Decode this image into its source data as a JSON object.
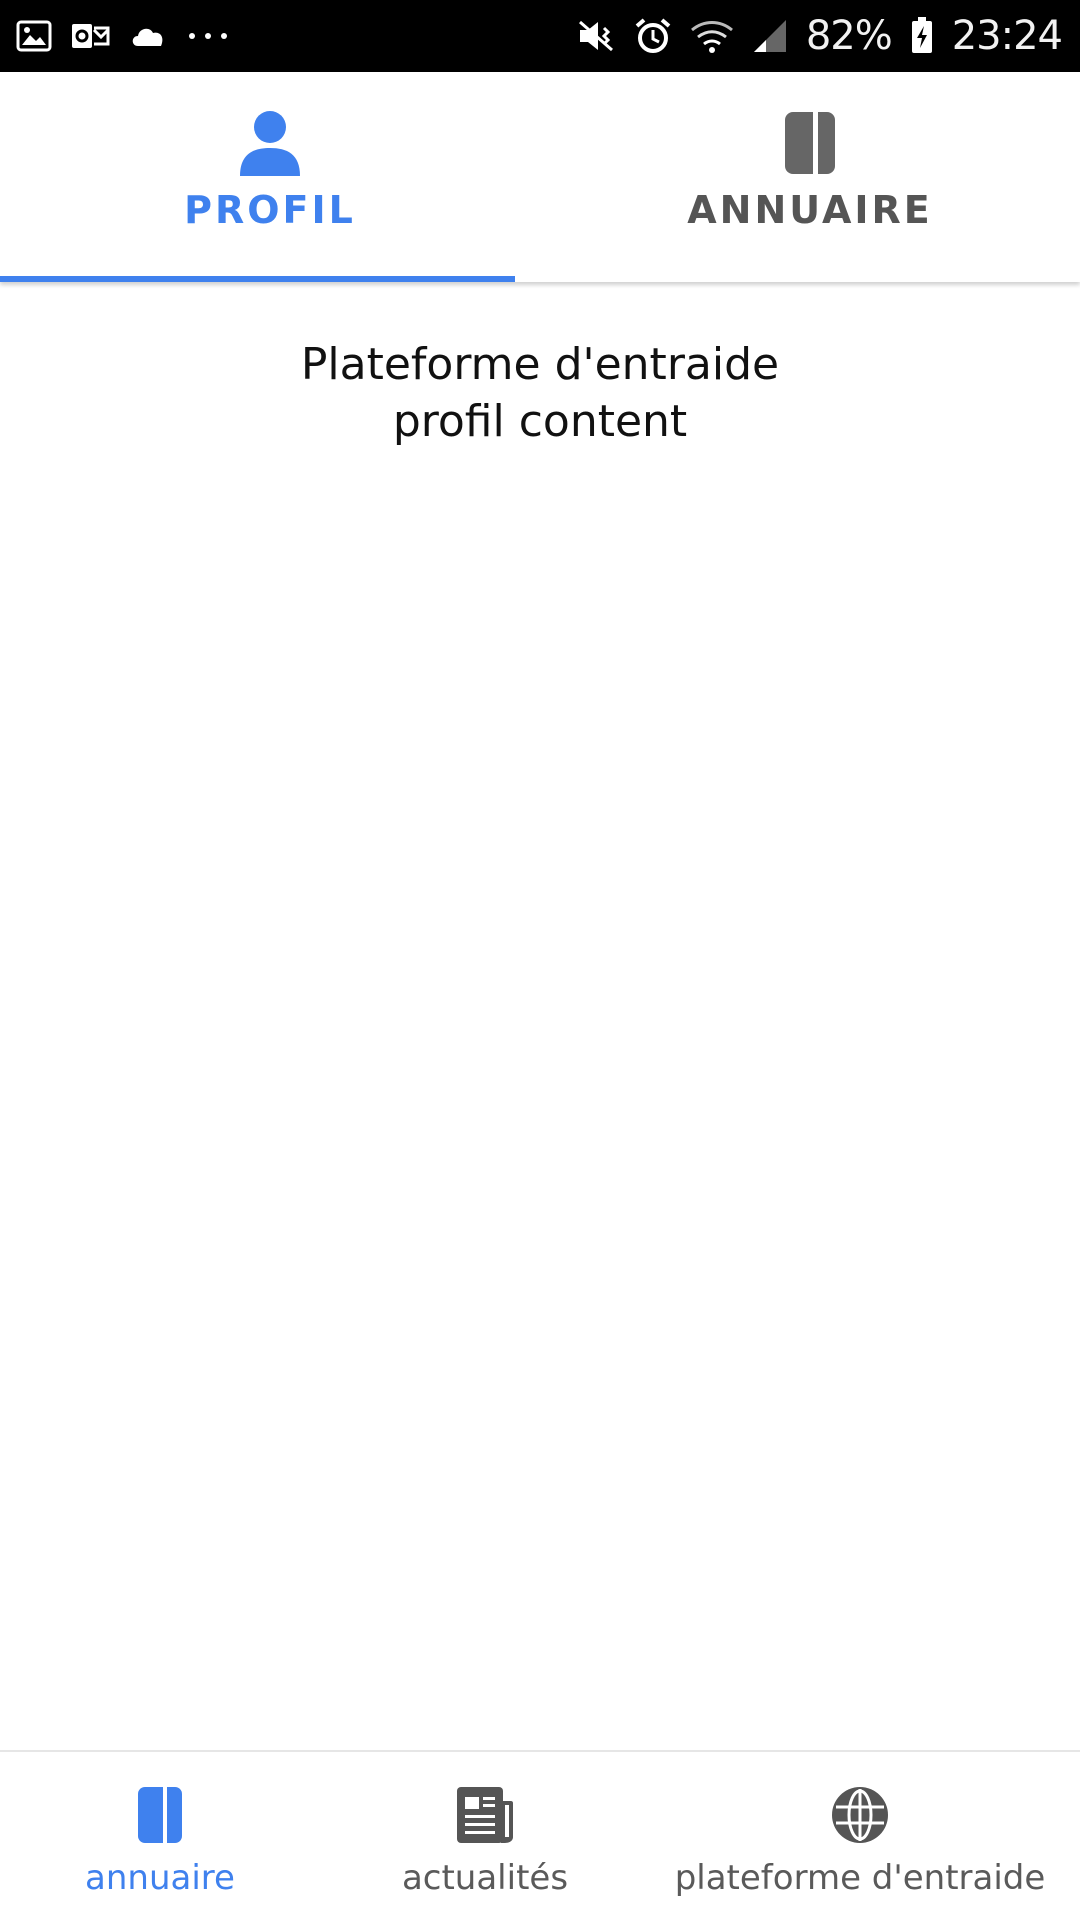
{
  "status_bar": {
    "battery": "82%",
    "time": "23:24",
    "icons_left": [
      "image-icon",
      "outlook-icon",
      "cloud-icon",
      "more-dots-icon"
    ],
    "icons_right": [
      "mute-vibrate-icon",
      "alarm-icon",
      "wifi-icon",
      "signal-icon",
      "battery-icon"
    ]
  },
  "top_tabs": [
    {
      "label": "PROFIL",
      "icon": "person-icon",
      "active": true
    },
    {
      "label": "ANNUAIRE",
      "icon": "book-icon",
      "active": false
    }
  ],
  "content": {
    "line1": "Plateforme d'entraide",
    "line2": "profil content"
  },
  "bottom_nav": [
    {
      "label": "annuaire",
      "icon": "book-icon",
      "active": true
    },
    {
      "label": "actualités",
      "icon": "newspaper-icon",
      "active": false
    },
    {
      "label": "plateforme d'entraide",
      "icon": "globe-icon",
      "active": false
    }
  ],
  "colors": {
    "accent": "#3f81ee",
    "inactive": "#5a5a5a",
    "status_bar_bg": "#000000"
  }
}
